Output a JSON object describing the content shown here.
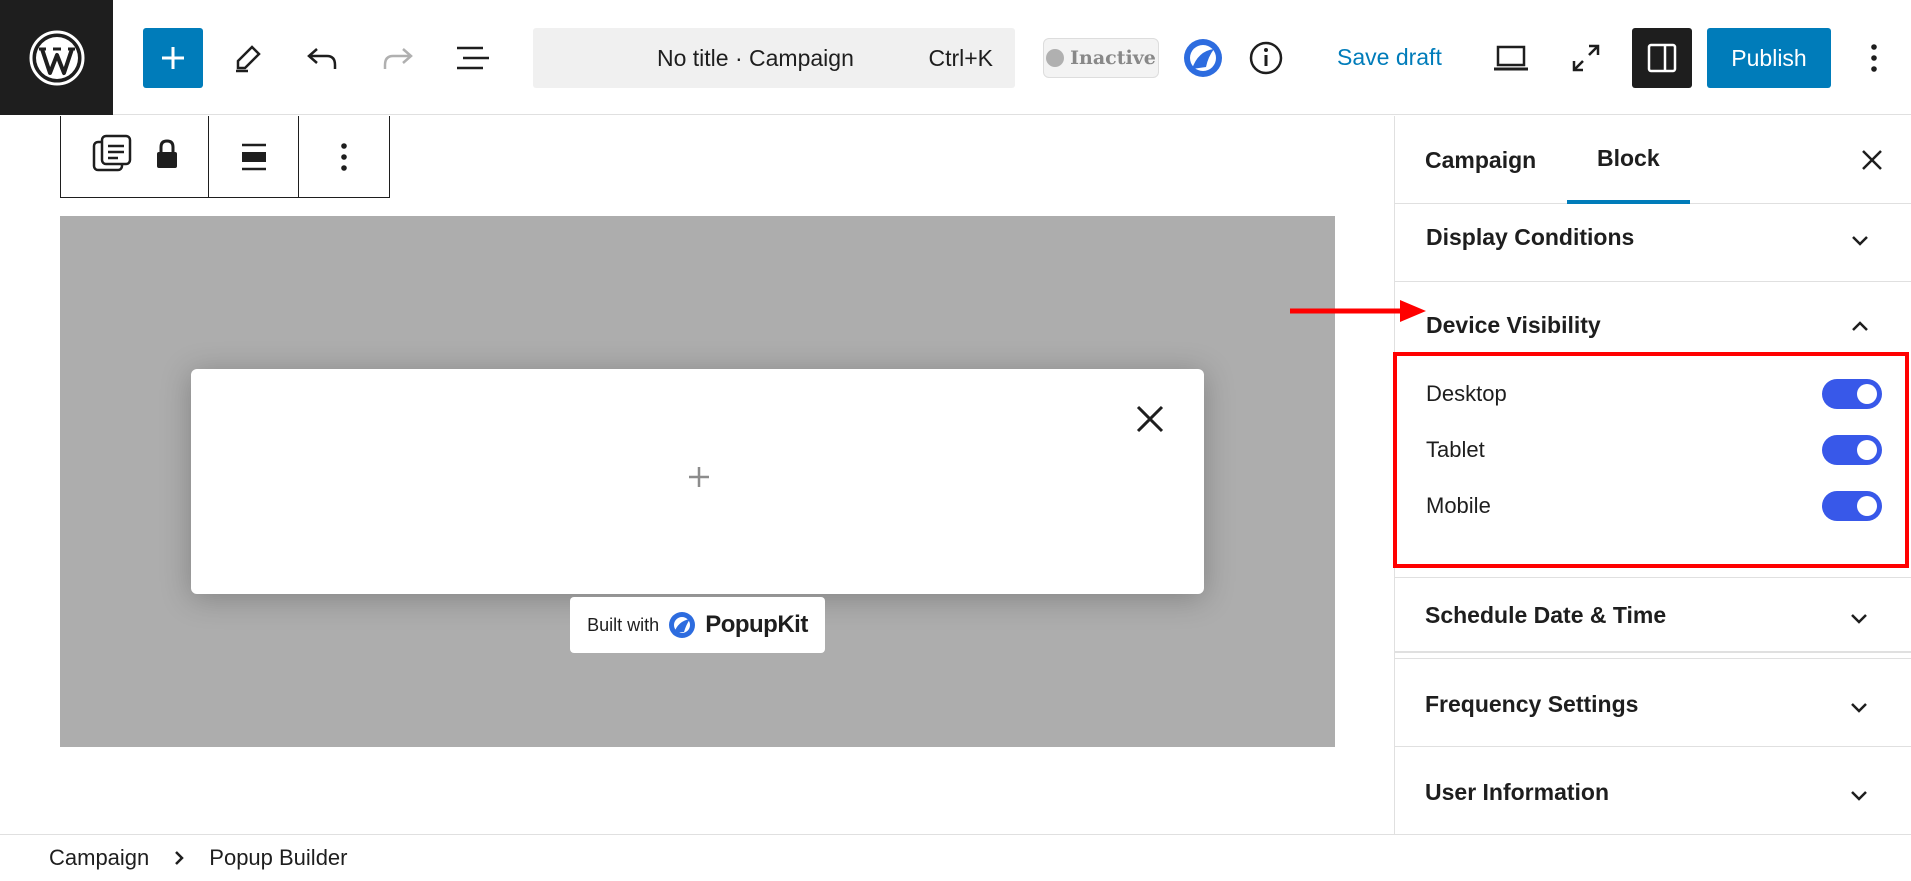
{
  "header": {
    "title": "No title · Campaign",
    "shortcut": "Ctrl+K",
    "status_badge": "Inactive",
    "save_draft_label": "Save draft",
    "publish_label": "Publish"
  },
  "popup": {
    "built_with_label": "Built with",
    "brand_name": "PopupKit"
  },
  "sidebar": {
    "tabs": [
      {
        "label": "Campaign",
        "active": false
      },
      {
        "label": "Block",
        "active": true
      }
    ],
    "panels": {
      "display_conditions": "Display Conditions",
      "device_visibility": "Device Visibility",
      "schedule": "Schedule Date & Time",
      "frequency": "Frequency Settings",
      "user_information": "User Information"
    },
    "device_toggles": [
      {
        "label": "Desktop",
        "enabled": true
      },
      {
        "label": "Tablet",
        "enabled": true
      },
      {
        "label": "Mobile",
        "enabled": true
      }
    ]
  },
  "breadcrumb": [
    "Campaign",
    "Popup Builder"
  ],
  "colors": {
    "accent": "#007cba",
    "toggle_on": "#3858e9",
    "annotation": "#ff0000",
    "overlay": "#adadad"
  }
}
